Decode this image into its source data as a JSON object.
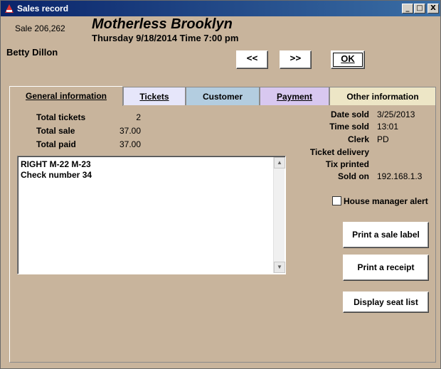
{
  "window": {
    "title": "Sales record",
    "controls": {
      "minimize": "_",
      "maximize": "□",
      "close": "X"
    }
  },
  "header": {
    "sale_number": "Sale 206,262",
    "event_title": "Motherless Brooklyn",
    "event_datetime": "Thursday 9/18/2014  Time 7:00 pm",
    "customer_name": "Betty Dillon"
  },
  "nav": {
    "prev_label": "<<",
    "next_label": ">>",
    "ok_label": "OK"
  },
  "tabs": [
    {
      "label": "General information",
      "color": "#c8b49c",
      "active": true
    },
    {
      "label": "Tickets",
      "color": "#e6e6fa"
    },
    {
      "label": "Customer",
      "color": "#b3cde0"
    },
    {
      "label": "Payment",
      "color": "#d8c8f0"
    },
    {
      "label": "Other information",
      "color": "#ede6c6"
    }
  ],
  "totals": {
    "tickets_label": "Total tickets",
    "tickets_value": "2",
    "sale_label": "Total sale",
    "sale_value": "37.00",
    "paid_label": "Total paid",
    "paid_value": "37.00"
  },
  "notes": {
    "text": "RIGHT M-22 M-23\nCheck number 34"
  },
  "details": {
    "date_sold_label": "Date sold",
    "date_sold_value": "3/25/2013",
    "time_sold_label": "Time sold",
    "time_sold_value": "13:01",
    "clerk_label": "Clerk",
    "clerk_value": "PD",
    "ticket_delivery_label": "Ticket delivery",
    "tix_printed_label": "Tix printed",
    "sold_on_label": "Sold on",
    "sold_on_value": "192.168.1.3"
  },
  "alert": {
    "label": "House manager alert",
    "checked": false
  },
  "actions": {
    "print_sale_label": "Print a sale label",
    "print_receipt": "Print a receipt",
    "display_seat_list": "Display seat list"
  },
  "colors": {
    "panel_background": "#c8b49c",
    "titlebar": "#0a246a"
  }
}
